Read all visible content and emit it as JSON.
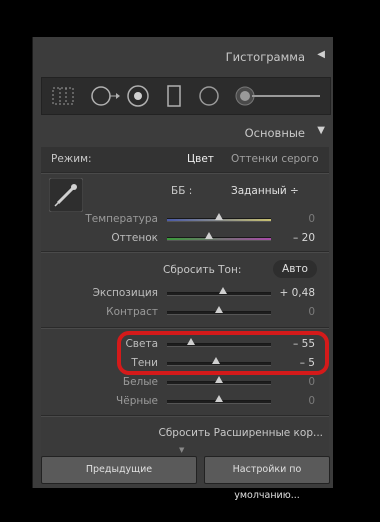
{
  "histogram": {
    "title": "Гистограмма",
    "collapse_icon": "triangle-left-icon"
  },
  "tools": [
    "grid-crop-icon",
    "spot-removal-icon",
    "red-eye-icon",
    "graduated-filter-icon",
    "radial-filter-icon",
    "adjustment-brush-icon"
  ],
  "basic": {
    "title": "Основные",
    "treatment_label": "Режим:",
    "treatment_color": "Цвет",
    "treatment_bw": "Оттенки серого",
    "wb_label": "ББ :",
    "wb_value": "Заданный ÷",
    "temperature_label": "Температура",
    "temperature_value": "0",
    "tint_label": "Оттенок",
    "tint_value": "– 20",
    "reset_tone": "Сбросить Тон:",
    "auto": "Авто",
    "exposure_label": "Экспозиция",
    "exposure_value": "+ 0,48",
    "contrast_label": "Контраст",
    "contrast_value": "0",
    "highlights_label": "Света",
    "highlights_value": "– 55",
    "shadows_label": "Тени",
    "shadows_value": "– 5",
    "whites_label": "Белые",
    "whites_value": "0",
    "blacks_label": "Чёрные",
    "blacks_value": "0",
    "reset_advanced": "Сбросить Расширенные кор..."
  },
  "footer": {
    "previous": "Предыдущие",
    "defaults": "Настройки по умолчанию..."
  },
  "colors": {
    "highlight": "#d41a1a",
    "panel": "#3c3c3c"
  }
}
